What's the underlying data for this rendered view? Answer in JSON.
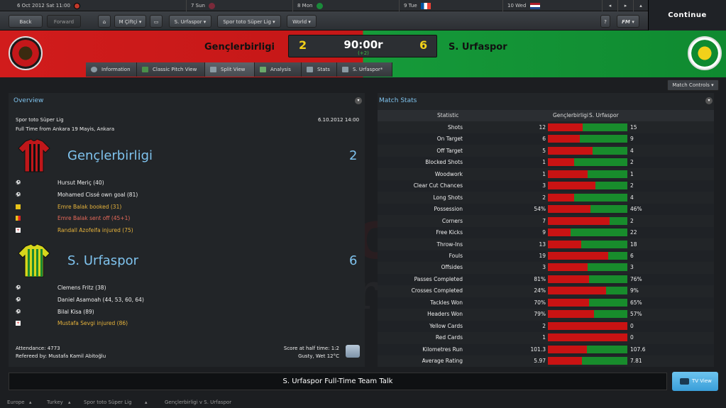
{
  "calendar": {
    "date": "6 Oct 2012",
    "day_time": "Sat 11:00",
    "days": [
      {
        "label": "7 Sun",
        "color": "#7a2a3a"
      },
      {
        "label": "8 Mon",
        "color": "#1a8a3a"
      },
      {
        "label": "9 Tue",
        "color": "#0055a4"
      },
      {
        "label": "10 Wed",
        "color": "#ae1c28"
      }
    ]
  },
  "nav": {
    "back": "Back",
    "forward": "Forward",
    "manager": "M Çiftçi",
    "club": "S. Urfaspor",
    "league": "Spor toto Süper Lig",
    "world": "World",
    "help": "?",
    "fm": "FM",
    "continue": "Continue"
  },
  "match": {
    "home": "Gençlerbirligi",
    "away": "S. Urfaspor",
    "home_score": "2",
    "away_score": "6",
    "clock": "90:00r",
    "added": "(+2)"
  },
  "tabs": [
    "Information",
    "Classic Pitch View",
    "Split View",
    "Analysis",
    "Stats",
    "S. Urfaspor*"
  ],
  "overview": {
    "title": "Overview",
    "competition": "Spor toto Süper Lig",
    "date": "6.10.2012 14:00",
    "venue": "Full Time from Ankara 19 Mayis, Ankara",
    "home_team": "Gençlerbirligi",
    "home_score": "2",
    "home_events": [
      {
        "text": "Hursut Meriç (40)",
        "type": "goal"
      },
      {
        "text": "Mohamed Cissé own goal (81)",
        "type": "own-goal"
      },
      {
        "text": "Emre Balak booked (31)",
        "type": "yellow"
      },
      {
        "text": "Emre Balak sent off (45+1)",
        "type": "red"
      },
      {
        "text": "Randall Azofeifa injured (75)",
        "type": "injury"
      }
    ],
    "away_team": "S. Urfaspor",
    "away_score": "6",
    "away_events": [
      {
        "text": "Clemens Fritz (38)",
        "type": "goal"
      },
      {
        "text": "Daniel Asamoah (44, 53, 60, 64)",
        "type": "goal"
      },
      {
        "text": "Bilal Kisa (89)",
        "type": "goal"
      },
      {
        "text": "Mustafa Sevgi injured (86)",
        "type": "injury"
      }
    ],
    "attendance": "Attendance: 4773",
    "referee": "Refereed by: Mustafa Kamil Abitoğlu",
    "half_time": "Score at half time: 1:2",
    "weather": "Gusty, Wet 12°C"
  },
  "match_controls": "Match Controls",
  "stats": {
    "title": "Match Stats",
    "col_statistic": "Statistic",
    "col_home": "Gençlerbirligi",
    "col_away": "S. Urfaspor",
    "rows": [
      {
        "label": "Shots",
        "home": "12",
        "away": "15",
        "share": 0.44
      },
      {
        "label": "On Target",
        "home": "6",
        "away": "9",
        "share": 0.4
      },
      {
        "label": "Off Target",
        "home": "5",
        "away": "4",
        "share": 0.56
      },
      {
        "label": "Blocked Shots",
        "home": "1",
        "away": "2",
        "share": 0.33
      },
      {
        "label": "Woodwork",
        "home": "1",
        "away": "1",
        "share": 0.5
      },
      {
        "label": "Clear Cut Chances",
        "home": "3",
        "away": "2",
        "share": 0.6
      },
      {
        "label": "Long Shots",
        "home": "2",
        "away": "4",
        "share": 0.33
      },
      {
        "label": "Possession",
        "home": "54%",
        "away": "46%",
        "share": 0.54
      },
      {
        "label": "Corners",
        "home": "7",
        "away": "2",
        "share": 0.78
      },
      {
        "label": "Free Kicks",
        "home": "9",
        "away": "22",
        "share": 0.29
      },
      {
        "label": "Throw-Ins",
        "home": "13",
        "away": "18",
        "share": 0.42
      },
      {
        "label": "Fouls",
        "home": "19",
        "away": "6",
        "share": 0.76
      },
      {
        "label": "Offsides",
        "home": "3",
        "away": "3",
        "share": 0.5
      },
      {
        "label": "Passes Completed",
        "home": "81%",
        "away": "76%",
        "share": 0.52
      },
      {
        "label": "Crosses Completed",
        "home": "24%",
        "away": "9%",
        "share": 0.73
      },
      {
        "label": "Tackles Won",
        "home": "70%",
        "away": "65%",
        "share": 0.52
      },
      {
        "label": "Headers Won",
        "home": "79%",
        "away": "57%",
        "share": 0.58
      },
      {
        "label": "Yellow Cards",
        "home": "2",
        "away": "0",
        "share": 1.0
      },
      {
        "label": "Red Cards",
        "home": "1",
        "away": "0",
        "share": 1.0
      },
      {
        "label": "Kilometres Run",
        "home": "101.3",
        "away": "107.6",
        "share": 0.49
      },
      {
        "label": "Average Rating",
        "home": "5.97",
        "away": "7.81",
        "share": 0.43
      }
    ]
  },
  "team_talk": "S. Urfaspor Full-Time Team Talk",
  "tv_view": "TV View",
  "breadcrumbs": [
    "Europe",
    "Turkey",
    "Spor toto Süper Lig",
    "Gençlerbirligi v S. Urfaspor"
  ]
}
